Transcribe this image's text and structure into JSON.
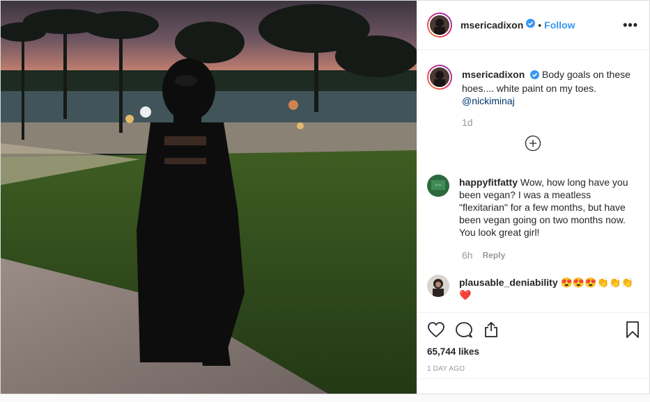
{
  "header": {
    "username": "msericadixon",
    "separator": "•",
    "follow_label": "Follow",
    "more_label": "•••"
  },
  "caption": {
    "username": "msericadixon",
    "text": "Body goals on these hoes.... white paint on my toes.",
    "mention": "@nickiminaj",
    "time": "1d"
  },
  "comments": [
    {
      "username": "happyfitfatty",
      "text": "Wow, how long have you been vegan? I was a meatless \"flexitarian\" for a few months, but have been vegan going on two months now. You look great girl!",
      "time": "6h",
      "reply_label": "Reply"
    },
    {
      "username": "plausable_deniability",
      "text": "😍😍😍👏👏👏❤️"
    }
  ],
  "stats": {
    "likes": "65,744 likes",
    "date": "1 DAY AGO"
  },
  "colors": {
    "accent": "#3897f0",
    "verified": "#3897f0",
    "text": "#262626",
    "muted": "#999999"
  },
  "icons": {
    "like": "heart-outline",
    "comment": "speech-bubble",
    "share": "share-arrow",
    "save": "bookmark",
    "load_more": "plus-circle"
  }
}
